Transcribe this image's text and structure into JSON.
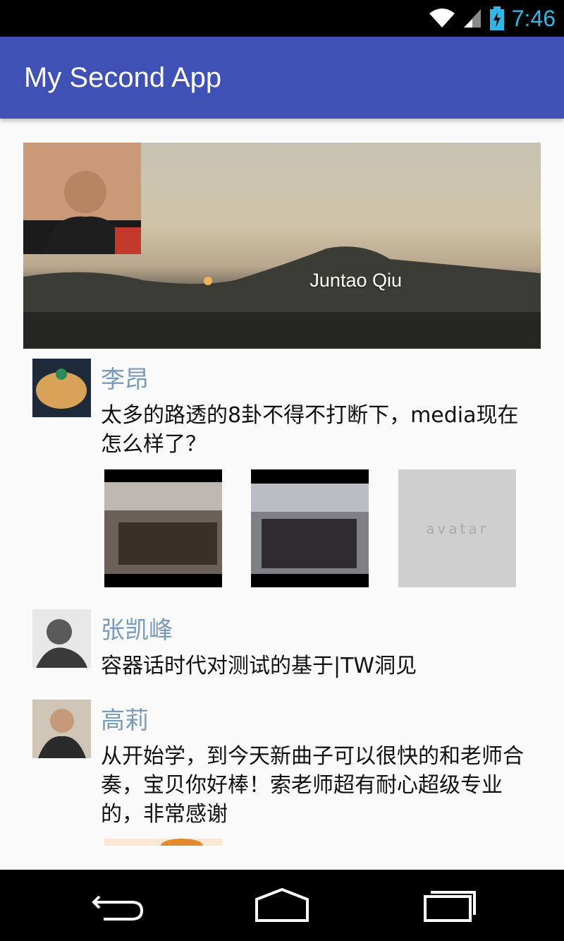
{
  "status_bar": {
    "time": "7:46"
  },
  "app_bar": {
    "title": "My Second App"
  },
  "header": {
    "name": "Juntao Qiu"
  },
  "posts": [
    {
      "name": "李昂",
      "content": "太多的路透的8卦不得不打断下，media现在怎么样了？",
      "placeholder_text": "avatar"
    },
    {
      "name": "张凯峰",
      "content": "容器话时代对测试的基于|TW洞见"
    },
    {
      "name": "高莉",
      "content": "从开始学，到今天新曲子可以很快的和老师合奏，宝贝你好棒！索老师超有耐心超级专业的，非常感谢"
    }
  ],
  "icons": [
    "wifi-icon",
    "signal-icon",
    "battery-icon",
    "back-icon",
    "home-icon",
    "recents-icon"
  ]
}
